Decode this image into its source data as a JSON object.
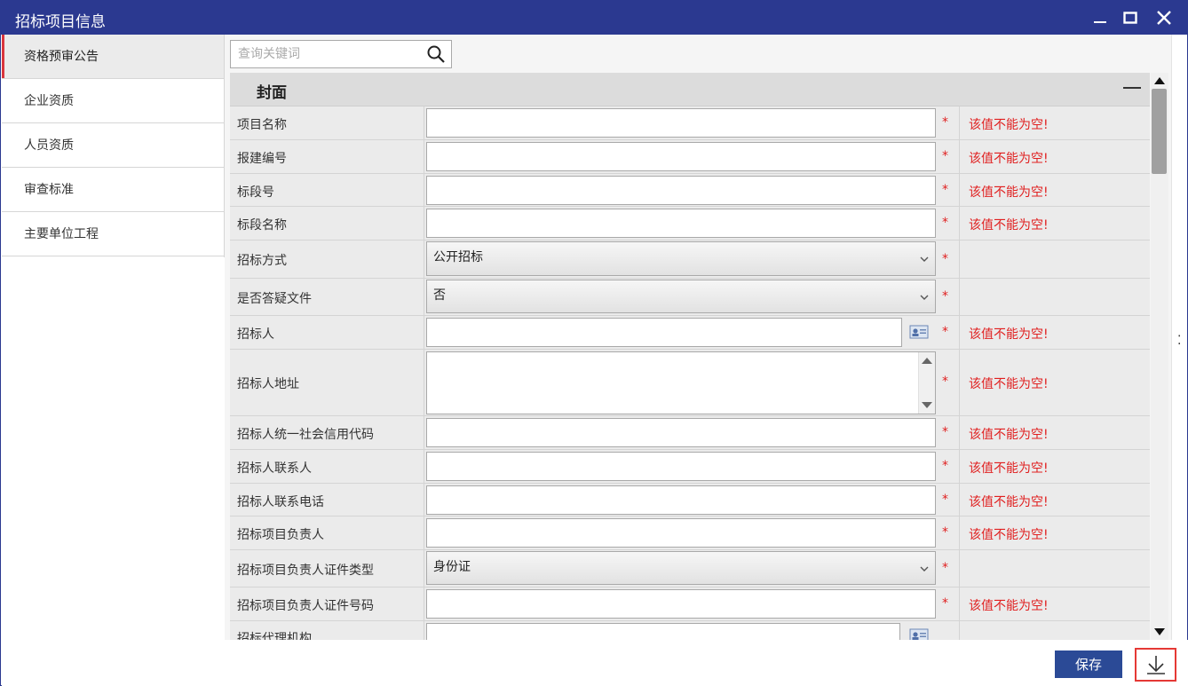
{
  "window": {
    "title": "招标项目信息"
  },
  "sidebar": {
    "items": [
      {
        "label": "资格预审公告",
        "active": true
      },
      {
        "label": "企业资质"
      },
      {
        "label": "人员资质"
      },
      {
        "label": "审查标准"
      },
      {
        "label": "主要单位工程"
      }
    ]
  },
  "search": {
    "placeholder": "查询关键词",
    "value": ""
  },
  "section": {
    "title": "封面"
  },
  "form": {
    "required_mark": "*",
    "error_text": "该值不能为空!",
    "rows": [
      {
        "label": "项目名称",
        "type": "text",
        "value": "",
        "error": "该值不能为空!"
      },
      {
        "label": "报建编号",
        "type": "text",
        "value": "",
        "error": "该值不能为空!"
      },
      {
        "label": "标段号",
        "type": "text",
        "value": "",
        "error": "该值不能为空!"
      },
      {
        "label": "标段名称",
        "type": "text",
        "value": "",
        "error": "该值不能为空!"
      },
      {
        "label": "招标方式",
        "type": "select",
        "value": "公开招标",
        "error": ""
      },
      {
        "label": "是否答疑文件",
        "type": "select",
        "value": "否",
        "error": ""
      },
      {
        "label": "招标人",
        "type": "text-picker",
        "value": "",
        "error": "该值不能为空!"
      },
      {
        "label": "招标人地址",
        "type": "textarea",
        "value": "",
        "error": "该值不能为空!"
      },
      {
        "label": "招标人统一社会信用代码",
        "type": "text",
        "value": "",
        "error": "该值不能为空!"
      },
      {
        "label": "招标人联系人",
        "type": "text",
        "value": "",
        "error": "该值不能为空!"
      },
      {
        "label": "招标人联系电话",
        "type": "text",
        "value": "",
        "error": "该值不能为空!"
      },
      {
        "label": "招标项目负责人",
        "type": "text",
        "value": "",
        "error": "该值不能为空!"
      },
      {
        "label": "招标项目负责人证件类型",
        "type": "select",
        "value": "身份证",
        "error": ""
      },
      {
        "label": "招标项目负责人证件号码",
        "type": "text",
        "value": "",
        "error": "该值不能为空!"
      },
      {
        "label": "招标代理机构",
        "type": "text-picker",
        "value": "",
        "error": ""
      }
    ]
  },
  "footer": {
    "save_label": "保存"
  },
  "icons": {
    "search": "search-icon",
    "minimize": "minimize-icon",
    "maximize": "maximize-icon",
    "close": "close-icon",
    "download": "download-icon",
    "contact": "contact-card-icon"
  },
  "colors": {
    "titlebar": "#2b3990",
    "error": "#e02020",
    "accent_active": "#d9363e",
    "save_button": "#2b4a96"
  }
}
